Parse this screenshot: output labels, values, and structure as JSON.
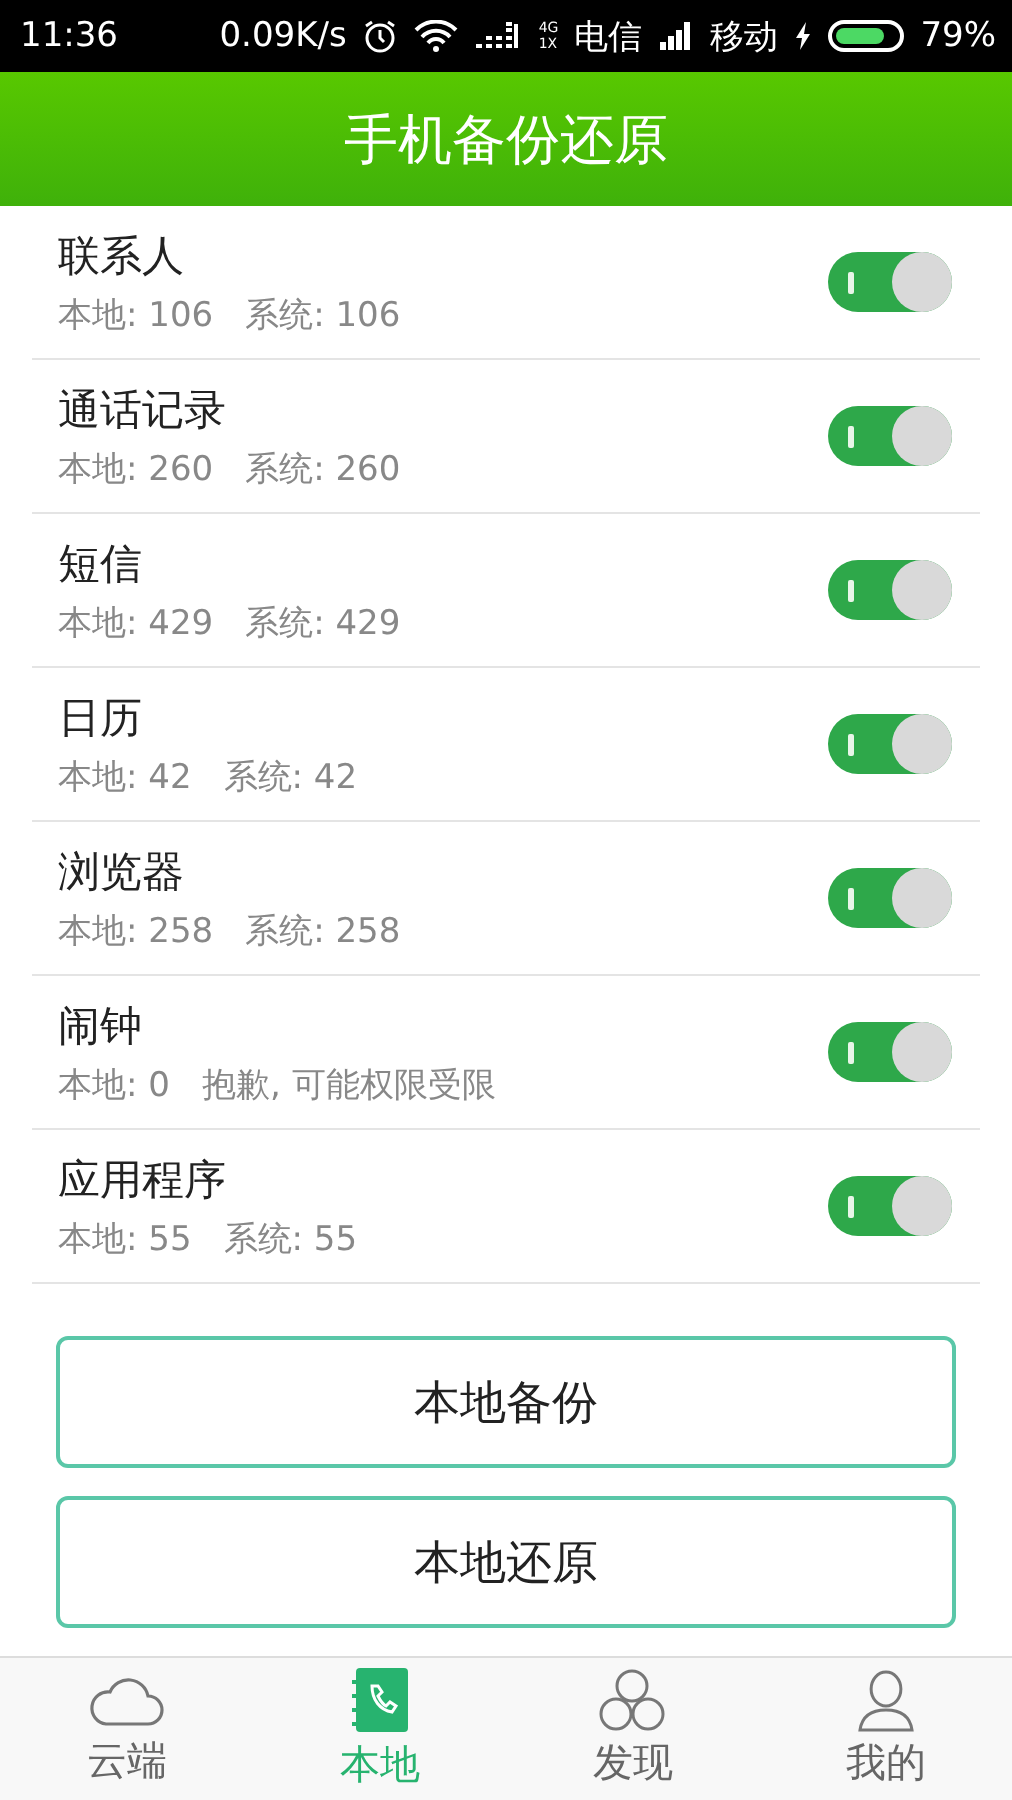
{
  "status_bar": {
    "time": "11:36",
    "speed": "0.09K/s",
    "net_top": "4G",
    "net_bottom": "1X",
    "carrier_1": "电信",
    "carrier_2": "移动",
    "battery": "79%"
  },
  "header": {
    "title": "手机备份还原"
  },
  "items": [
    {
      "name": "联系人",
      "local": "本地: 106",
      "system": "系统: 106",
      "on": true
    },
    {
      "name": "通话记录",
      "local": "本地: 260",
      "system": "系统: 260",
      "on": true
    },
    {
      "name": "短信",
      "local": "本地: 429",
      "system": "系统: 429",
      "on": true
    },
    {
      "name": "日历",
      "local": "本地: 42",
      "system": "系统: 42",
      "on": true
    },
    {
      "name": "浏览器",
      "local": "本地: 258",
      "system": "系统: 258",
      "on": true
    },
    {
      "name": "闹钟",
      "local": "本地: 0",
      "system": "抱歉, 可能权限受限",
      "on": true
    },
    {
      "name": "应用程序",
      "local": "本地: 55",
      "system": "系统: 55",
      "on": true
    }
  ],
  "buttons": [
    "本地备份",
    "本地还原"
  ],
  "tabs": [
    {
      "label": "云端",
      "kind": "cloud",
      "selected": false
    },
    {
      "label": "本地",
      "kind": "contacts",
      "selected": true
    },
    {
      "label": "发现",
      "kind": "circles",
      "selected": false
    },
    {
      "label": "我的",
      "kind": "person",
      "selected": false
    }
  ]
}
